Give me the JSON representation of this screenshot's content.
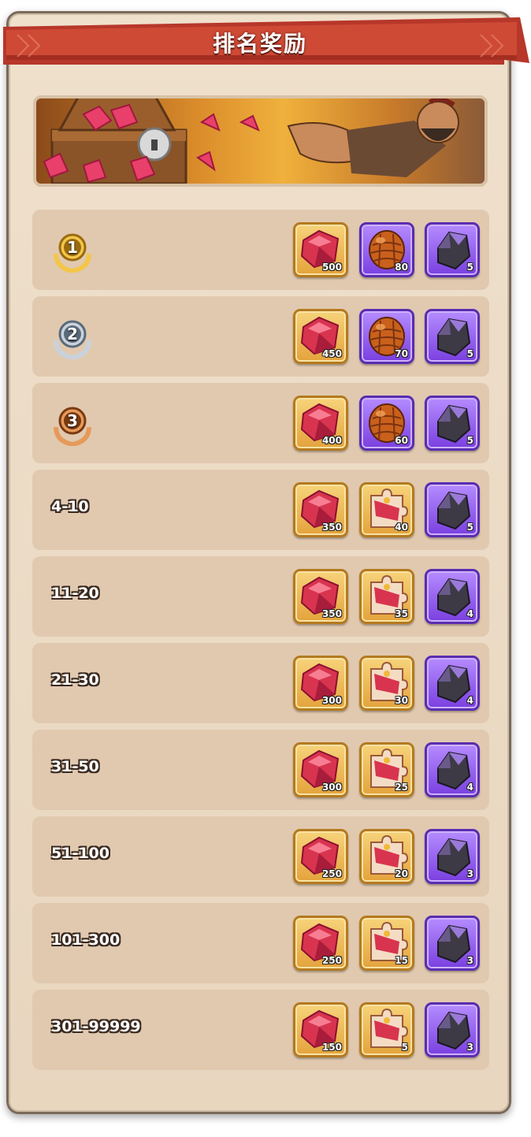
{
  "title": "排名奖励",
  "colors": {
    "gold_frame": "#e4a33c",
    "purple_frame": "#7a3fe0",
    "banner_red": "#c7412e",
    "row_bg": "#e1c9b0"
  },
  "rows": [
    {
      "rank": "1",
      "medal": "gold-medal-icon",
      "rewards": [
        {
          "icon": "ruby-gem-icon",
          "frame": "gold",
          "qty": "500"
        },
        {
          "icon": "dragon-egg-icon",
          "frame": "purple",
          "qty": "80"
        },
        {
          "icon": "dark-crystal-icon",
          "frame": "purple",
          "qty": "5"
        }
      ]
    },
    {
      "rank": "2",
      "medal": "silver-medal-icon",
      "rewards": [
        {
          "icon": "ruby-gem-icon",
          "frame": "gold",
          "qty": "450"
        },
        {
          "icon": "dragon-egg-icon",
          "frame": "purple",
          "qty": "70"
        },
        {
          "icon": "dark-crystal-icon",
          "frame": "purple",
          "qty": "5"
        }
      ]
    },
    {
      "rank": "3",
      "medal": "bronze-medal-icon",
      "rewards": [
        {
          "icon": "ruby-gem-icon",
          "frame": "gold",
          "qty": "400"
        },
        {
          "icon": "dragon-egg-icon",
          "frame": "purple",
          "qty": "60"
        },
        {
          "icon": "dark-crystal-icon",
          "frame": "purple",
          "qty": "5"
        }
      ]
    },
    {
      "rank": "4-10",
      "rewards": [
        {
          "icon": "ruby-gem-icon",
          "frame": "gold",
          "qty": "350"
        },
        {
          "icon": "puzzle-piece-icon",
          "frame": "gold",
          "qty": "40"
        },
        {
          "icon": "dark-crystal-icon",
          "frame": "purple",
          "qty": "5"
        }
      ]
    },
    {
      "rank": "11-20",
      "rewards": [
        {
          "icon": "ruby-gem-icon",
          "frame": "gold",
          "qty": "350"
        },
        {
          "icon": "puzzle-piece-icon",
          "frame": "gold",
          "qty": "35"
        },
        {
          "icon": "dark-crystal-icon",
          "frame": "purple",
          "qty": "4"
        }
      ]
    },
    {
      "rank": "21-30",
      "rewards": [
        {
          "icon": "ruby-gem-icon",
          "frame": "gold",
          "qty": "300"
        },
        {
          "icon": "puzzle-piece-icon",
          "frame": "gold",
          "qty": "30"
        },
        {
          "icon": "dark-crystal-icon",
          "frame": "purple",
          "qty": "4"
        }
      ]
    },
    {
      "rank": "31-50",
      "rewards": [
        {
          "icon": "ruby-gem-icon",
          "frame": "gold",
          "qty": "300"
        },
        {
          "icon": "puzzle-piece-icon",
          "frame": "gold",
          "qty": "25"
        },
        {
          "icon": "dark-crystal-icon",
          "frame": "purple",
          "qty": "4"
        }
      ]
    },
    {
      "rank": "51-100",
      "rewards": [
        {
          "icon": "ruby-gem-icon",
          "frame": "gold",
          "qty": "250"
        },
        {
          "icon": "puzzle-piece-icon",
          "frame": "gold",
          "qty": "20"
        },
        {
          "icon": "dark-crystal-icon",
          "frame": "purple",
          "qty": "3"
        }
      ]
    },
    {
      "rank": "101-300",
      "rewards": [
        {
          "icon": "ruby-gem-icon",
          "frame": "gold",
          "qty": "250"
        },
        {
          "icon": "puzzle-piece-icon",
          "frame": "gold",
          "qty": "15"
        },
        {
          "icon": "dark-crystal-icon",
          "frame": "purple",
          "qty": "3"
        }
      ]
    },
    {
      "rank": "301-99999",
      "rewards": [
        {
          "icon": "ruby-gem-icon",
          "frame": "gold",
          "qty": "150"
        },
        {
          "icon": "puzzle-piece-icon",
          "frame": "gold",
          "qty": "5"
        },
        {
          "icon": "dark-crystal-icon",
          "frame": "purple",
          "qty": "3"
        }
      ]
    }
  ]
}
